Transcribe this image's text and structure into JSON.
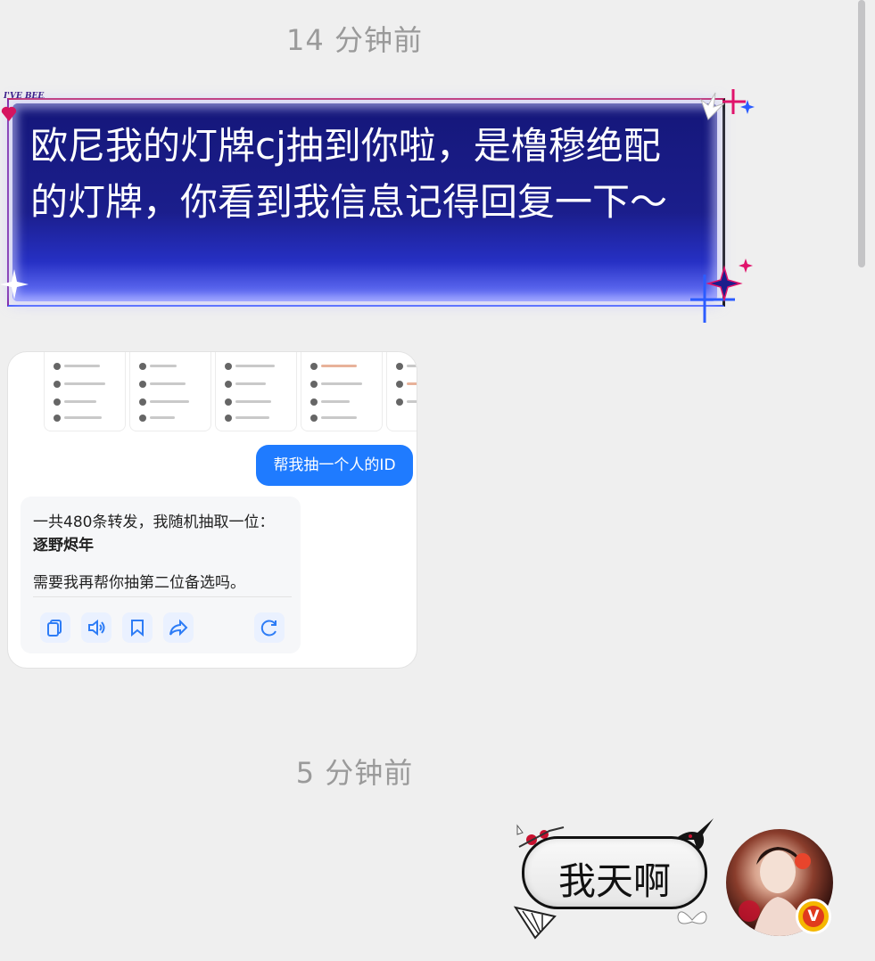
{
  "timestamps": {
    "first": "14 分钟前",
    "second": "5 分钟前"
  },
  "messages": {
    "incoming_text": "欧尼我的灯牌cj抽到你啦，是橹穆绝配的灯牌，你看到我信息记得回复一下～",
    "incoming_bubble_colors": {
      "top": "#15177a",
      "bottom": "#6f7cff"
    },
    "bubble_decoration_text": "I'VE BEEN",
    "outgoing_text": "我天啊"
  },
  "screenshot_card": {
    "user_prompt": "帮我抽一个人的ID",
    "answer_line1": "一共480条转发，我随机抽取一位：",
    "answer_name": "逐野烬年",
    "answer_line3": "需要我再帮你抽第二位备选吗。",
    "actions": [
      "copy-icon",
      "speaker-icon",
      "bookmark-icon",
      "share-icon",
      "refresh-icon"
    ]
  },
  "avatar": {
    "badge_label": "V",
    "badge_color": "#f5b700"
  },
  "accent_colors": {
    "user_pill": "#1f7bff",
    "action_icon": "#2d7cf6"
  }
}
